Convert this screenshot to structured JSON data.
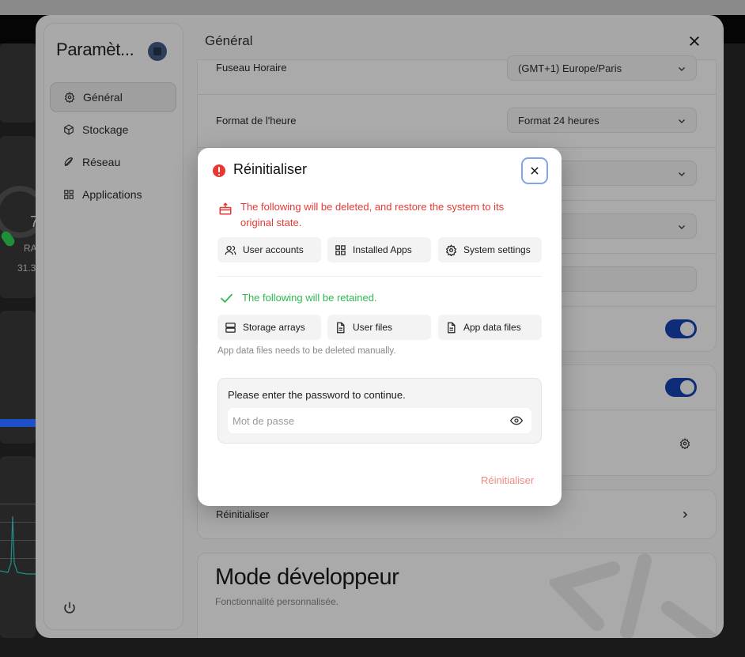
{
  "background": {
    "gauge_partial_text": "7",
    "ram_label_partial": "RA",
    "ram_value_partial": "31.3"
  },
  "sidebar": {
    "title": "Paramèt...",
    "items": [
      {
        "label": "Général",
        "icon": "gear-icon",
        "active": true
      },
      {
        "label": "Stockage",
        "icon": "cube-icon",
        "active": false
      },
      {
        "label": "Réseau",
        "icon": "network-icon",
        "active": false
      },
      {
        "label": "Applications",
        "icon": "apps-grid-icon",
        "active": false
      }
    ]
  },
  "content": {
    "title": "Général",
    "rows": {
      "timezone_label": "Fuseau Horaire",
      "timezone_value": "(GMT+1) Europe/Paris",
      "time_format_label": "Format de l'heure",
      "time_format_value": "Format 24 heures",
      "reset_label": "Réinitialiser"
    },
    "developer": {
      "title": "Mode développeur",
      "subtitle": "Fonctionnalité personnalisée."
    }
  },
  "modal": {
    "title": "Réinitialiser",
    "delete_warning": "The following will be deleted, and restore the system to its original state.",
    "delete_items": [
      {
        "label": "User accounts",
        "icon": "users-icon"
      },
      {
        "label": "Installed Apps",
        "icon": "apps-grid-icon"
      },
      {
        "label": "System settings",
        "icon": "gear-icon"
      }
    ],
    "retain_text": "The following will be retained.",
    "retain_items": [
      {
        "label": "Storage arrays",
        "icon": "server-icon"
      },
      {
        "label": "User files",
        "icon": "file-icon"
      },
      {
        "label": "App data files",
        "icon": "file-icon"
      }
    ],
    "note": "App data files needs to be deleted manually.",
    "password_prompt": "Please enter the password to continue.",
    "password_placeholder": "Mot de passe",
    "password_value": "",
    "submit_label": "Réinitialiser"
  },
  "colors": {
    "danger": "#e53935",
    "success": "#2eb84f",
    "submit_disabled": "#f08a85",
    "focus_ring": "#7fa6e6",
    "toggle_on": "#0f2c79"
  }
}
